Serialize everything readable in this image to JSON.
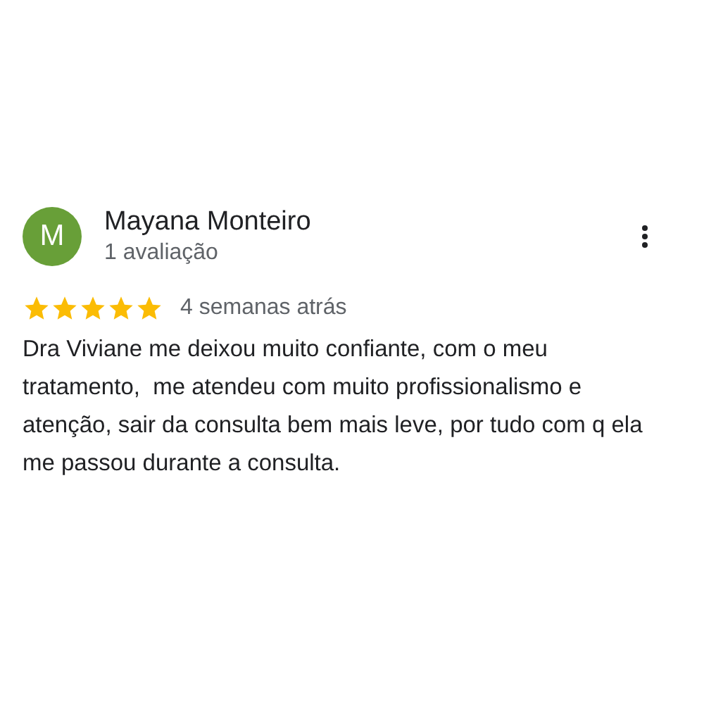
{
  "review": {
    "avatar_letter": "M",
    "author": "Mayana Monteiro",
    "subtitle": "1 avaliação",
    "stars": 5,
    "time": "4 semanas atrás",
    "text": "Dra Viviane me deixou muito confiante, com o meu tratamento,  me atendeu com muito profissionalismo e atenção, sair da consulta bem mais leve, por tudo com q ela me passou durante a consulta."
  }
}
